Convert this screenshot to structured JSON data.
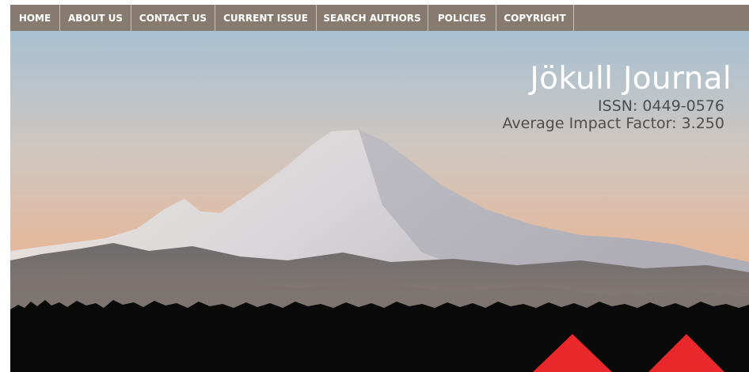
{
  "nav": {
    "items": [
      {
        "label": "HOME"
      },
      {
        "label": "ABOUT US"
      },
      {
        "label": "CONTACT US"
      },
      {
        "label": "CURRENT ISSUE"
      },
      {
        "label": "SEARCH AUTHORS"
      },
      {
        "label": "POLICIES"
      },
      {
        "label": "COPYRIGHT"
      }
    ]
  },
  "header": {
    "title": "Jökull Journal",
    "issn": "ISSN: 0449-0576",
    "impact": "Average Impact Factor: 3.250"
  },
  "colors": {
    "nav_bg": "#877b70",
    "accent_red": "#e8282b",
    "sky_top": "#a9c2d2",
    "sky_bottom": "#e4b79a"
  }
}
